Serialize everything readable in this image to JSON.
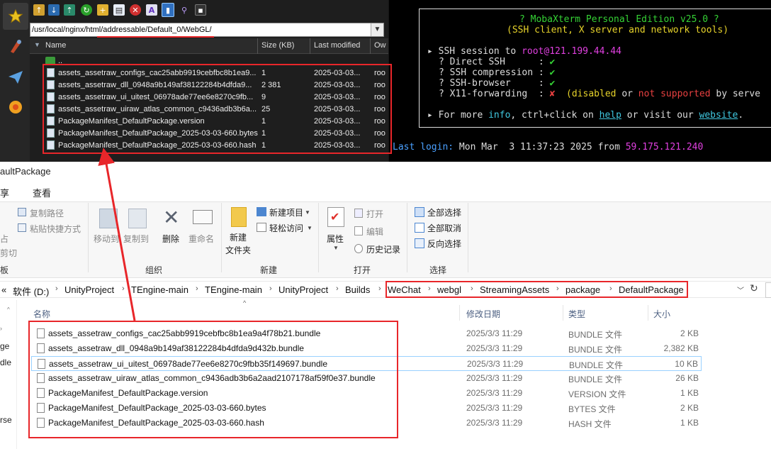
{
  "sftp": {
    "path": "/usr/local/nginx/html/addressable/Default_0/WebGL/",
    "columns": [
      "Name",
      "Size (KB)",
      "Last modified",
      "Ow"
    ],
    "parent_label": "..",
    "files": [
      {
        "name": "assets_assetraw_configs_cac25abb9919cebfbc8b1ea9...",
        "size": "1",
        "modified": "2025-03-03...",
        "owner": "roo"
      },
      {
        "name": "assets_assetraw_dll_0948a9b149af38122284b4dfda9...",
        "size": "2 381",
        "modified": "2025-03-03...",
        "owner": "roo"
      },
      {
        "name": "assets_assetraw_ui_uitest_06978ade77ee6e8270c9fb...",
        "size": "9",
        "modified": "2025-03-03...",
        "owner": "roo"
      },
      {
        "name": "assets_assetraw_uiraw_atlas_common_c9436adb3b6a...",
        "size": "25",
        "modified": "2025-03-03...",
        "owner": "roo"
      },
      {
        "name": "PackageManifest_DefaultPackage.version",
        "size": "1",
        "modified": "2025-03-03...",
        "owner": "roo"
      },
      {
        "name": "PackageManifest_DefaultPackage_2025-03-03-660.bytes",
        "size": "1",
        "modified": "2025-03-03...",
        "owner": "roo"
      },
      {
        "name": "PackageManifest_DefaultPackage_2025-03-03-660.hash",
        "size": "1",
        "modified": "2025-03-03...",
        "owner": "roo"
      }
    ]
  },
  "terminal": {
    "title": "? MobaXterm Personal Edition v25.0 ?",
    "subtitle": "(SSH client, X server and network tools)",
    "session_prefix": "▸ SSH session to ",
    "session_host": "root@121.199.44.44",
    "checks": [
      {
        "label": "? Direct SSH      :",
        "mark": "✔"
      },
      {
        "label": "? SSH compression :",
        "mark": "✔"
      },
      {
        "label": "? SSH-browser     :",
        "mark": "✔"
      }
    ],
    "x11_label": "? X11-forwarding  :",
    "x11_mark": "✘",
    "x11_note_pre": "(disabled",
    "x11_or": "or",
    "x11_not_supported": "not supported",
    "x11_by": "by serve",
    "more_pre": "▸ For more ",
    "more_info": "info",
    "more_mid": ", ctrl+click on ",
    "more_help": "help",
    "more_visit": " or visit our ",
    "more_website": "website",
    "more_end": ".",
    "last_login_label": "Last login:",
    "last_login_time": "Mon Mar  3 11:37:23 2025 from",
    "last_login_ip": "59.175.121.240"
  },
  "explorer": {
    "window_title": "aultPackage",
    "tabs": [
      "享",
      "查看"
    ],
    "ribbon": {
      "copy_path": "复制路径",
      "paste_shortcut": "粘贴快捷方式",
      "left_partial_1": "占",
      "left_partial_2": "剪切",
      "clipboard_partial": "板",
      "move_to": "移动到",
      "copy_to": "复制到",
      "delete": "删除",
      "rename": "重命名",
      "organize": "组织",
      "new_folder_1": "新建",
      "new_folder_2": "文件夹",
      "new_item": "新建项目",
      "easy_access": "轻松访问",
      "new_group": "新建",
      "properties": "属性",
      "open": "打开",
      "edit": "编辑",
      "history": "历史记录",
      "open_group": "打开",
      "select_all": "全部选择",
      "select_none": "全部取消",
      "invert": "反向选择",
      "select_group": "选择"
    },
    "breadcrumb": [
      "«",
      "软件 (D:)",
      "UnityProject",
      "TEngine-main",
      "TEngine-main",
      "UnityProject",
      "Builds",
      "WeChat",
      "webgl",
      "StreamingAssets",
      "package",
      "DefaultPackage"
    ],
    "columns": {
      "name": "名称",
      "modified": "修改日期",
      "type": "类型",
      "size": "大小"
    },
    "files": [
      {
        "name": "assets_assetraw_configs_cac25abb9919cebfbc8b1ea9a4f78b21.bundle",
        "modified": "2025/3/3 11:29",
        "type": "BUNDLE 文件",
        "size": "2 KB"
      },
      {
        "name": "assets_assetraw_dll_0948a9b149af38122284b4dfda9d432b.bundle",
        "modified": "2025/3/3 11:29",
        "type": "BUNDLE 文件",
        "size": "2,382 KB"
      },
      {
        "name": "assets_assetraw_ui_uitest_06978ade77ee6e8270c9fbb35f149697.bundle",
        "modified": "2025/3/3 11:29",
        "type": "BUNDLE 文件",
        "size": "10 KB"
      },
      {
        "name": "assets_assetraw_uiraw_atlas_common_c9436adb3b6a2aad2107178af59f0e37.bundle",
        "modified": "2025/3/3 11:29",
        "type": "BUNDLE 文件",
        "size": "26 KB"
      },
      {
        "name": "PackageManifest_DefaultPackage.version",
        "modified": "2025/3/3 11:29",
        "type": "VERSION 文件",
        "size": "1 KB"
      },
      {
        "name": "PackageManifest_DefaultPackage_2025-03-03-660.bytes",
        "modified": "2025/3/3 11:29",
        "type": "BYTES 文件",
        "size": "2 KB"
      },
      {
        "name": "PackageManifest_DefaultPackage_2025-03-03-660.hash",
        "modified": "2025/3/3 11:29",
        "type": "HASH 文件",
        "size": "1 KB"
      }
    ],
    "left_nav_partial": [
      "ge",
      "dle",
      "rse"
    ]
  },
  "colors": {
    "annotation_red": "#e8262a",
    "terminal_green": "#35d235",
    "terminal_yellow": "#e6d22a",
    "terminal_magenta": "#e040e0",
    "terminal_cyan": "#40c8e0",
    "terminal_red": "#e84040",
    "login_blue": "#4aa0ff"
  }
}
